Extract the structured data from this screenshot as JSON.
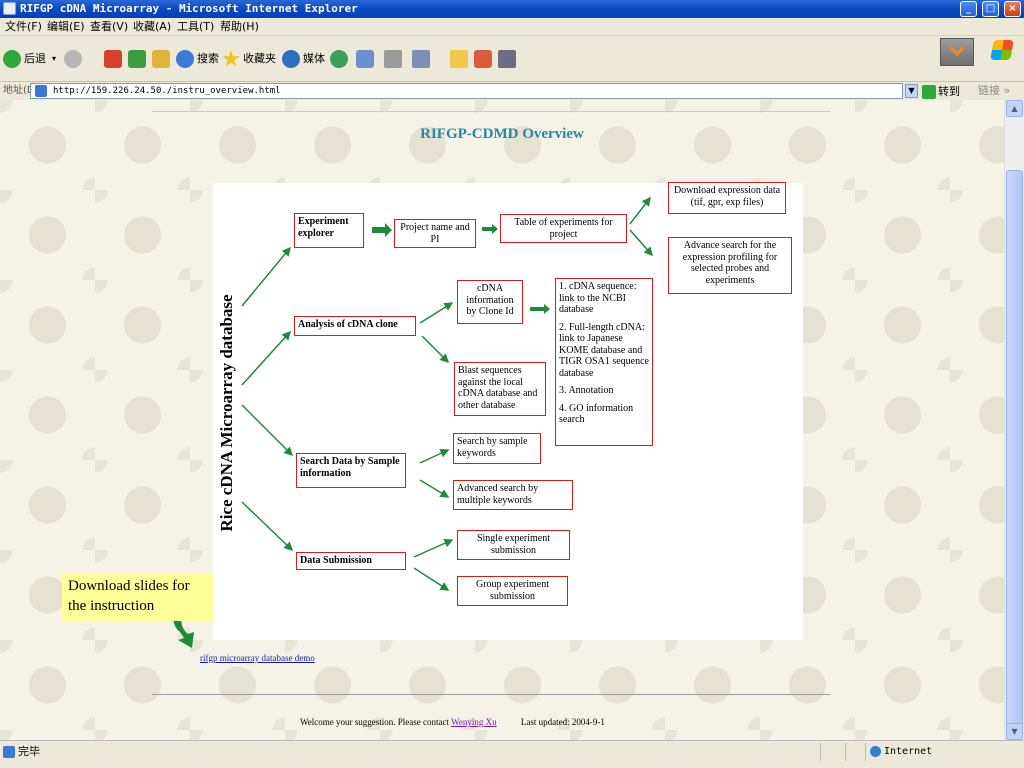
{
  "window": {
    "title": "RIFGP cDNA Microarray - Microsoft Internet Explorer",
    "min_glyph": "_",
    "max_glyph": "□",
    "close_glyph": "×"
  },
  "menu": [
    "文件(F)",
    "编辑(E)",
    "查看(V)",
    "收藏(A)",
    "工具(T)",
    "帮助(H)"
  ],
  "toolbar": {
    "back": "后退",
    "search": "搜索",
    "favorites": "收藏夹",
    "media": "媒体"
  },
  "address": {
    "label": "地址(D)",
    "url": "http://159.226.24.50./instru_overview.html",
    "go": "转到",
    "links": "链接 »"
  },
  "scrollbar": {
    "up": "▲",
    "down": "▼"
  },
  "status": {
    "left": "完毕",
    "zone": "Internet"
  },
  "page": {
    "title": "RIFGP-CDMD Overview",
    "vertical_label": "Rice cDNA Microarray database",
    "boxes": {
      "experiment_explorer": "Experiment explorer",
      "project_name": "Project name and PI",
      "table_experiments": "Table of experiments for project",
      "download_expression": "Download expression data (tif, gpr, exp files)",
      "advance_search_profiling": "Advance search for the expression profiling for selected probes and experiments",
      "analysis_cdna": "Analysis of cDNA clone",
      "cdna_info": "cDNA information by Clone Id",
      "cdna_details": [
        "1. cDNA sequence: link to the NCBI database",
        "2. Full-length cDNA: link to Japanese KOME database and TIGR OSA1 sequence database",
        "3. Annotation",
        "4. GO information search"
      ],
      "blast": "Blast sequences against the local cDNA database and other database",
      "search_data": "Search Data by Sample information",
      "search_keywords": "Search by sample keywords",
      "advanced_search_keywords": "Advanced search by multiple keywords",
      "data_submission": "Data Submission",
      "single_submission": "Single experiment submission",
      "group_submission": "Group experiment submission"
    },
    "callout": "Download slides for the instruction",
    "demo_link": "rifgp microarray database demo",
    "footer": {
      "text": "Welcome your suggestion. Please contact",
      "contact": "Wenying Xu",
      "updated": "Last updated: 2004-9-1"
    }
  },
  "colors": {
    "title_teal": "#1f8aa6",
    "box_border": "#d01e1e",
    "arrow_green": "#1e8a3c",
    "callout_yellow": "#ffff9a"
  }
}
